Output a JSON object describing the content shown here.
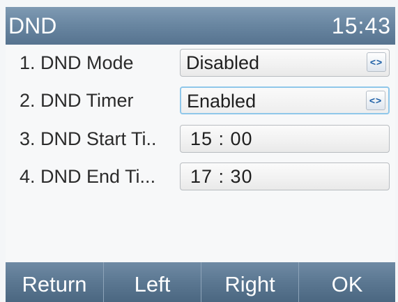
{
  "header": {
    "title": "DND",
    "clock": "15:43"
  },
  "rows": [
    {
      "label": "1. DND Mode",
      "value": "Disabled",
      "control": "selector",
      "focused": false
    },
    {
      "label": "2. DND Timer",
      "value": "Enabled",
      "control": "selector",
      "focused": true
    },
    {
      "label": "3. DND Start Ti..",
      "value": "15 : 00",
      "control": "time"
    },
    {
      "label": "4. DND End Ti...",
      "value": "17 : 30",
      "control": "time"
    }
  ],
  "selector_symbol": "<>",
  "softkeys": [
    "Return",
    "Left",
    "Right",
    "OK"
  ],
  "colors": {
    "header": "#6a87a2",
    "softkey_bar": "#5b7791",
    "focus_border": "#8fc7ea",
    "arrow": "#1d5fa6"
  }
}
